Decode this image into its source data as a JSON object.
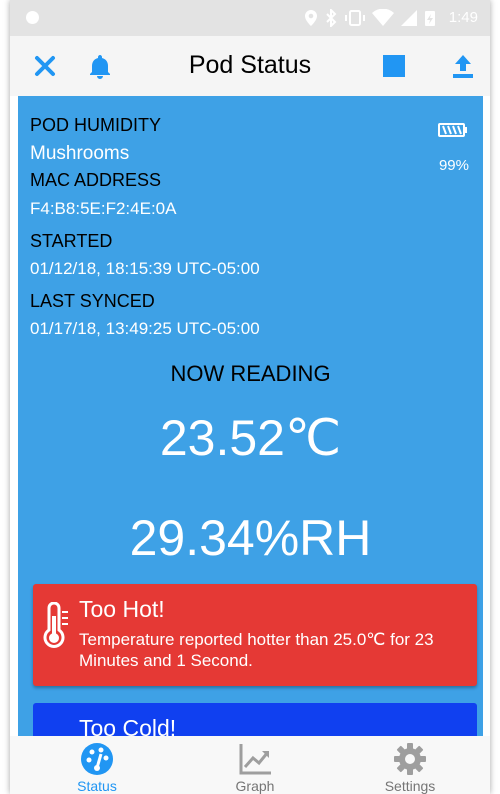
{
  "statusbar": {
    "time": "1:49"
  },
  "toolbar": {
    "title": "Pod Status"
  },
  "pod": {
    "humidity_label": "POD HUMIDITY",
    "humidity_value": "Mushrooms",
    "mac_label": "MAC ADDRESS",
    "mac_value": "F4:B8:5E:F2:4E:0A",
    "started_label": "STARTED",
    "started_value": "01/12/18, 18:15:39 UTC-05:00",
    "synced_label": "LAST SYNCED",
    "synced_value": "01/17/18, 13:49:25 UTC-05:00",
    "battery": "99%"
  },
  "reading": {
    "title": "NOW READING",
    "temperature": "23.52℃",
    "humidity": "29.34%RH"
  },
  "alerts": [
    {
      "title": "Too Hot!",
      "message": "Temperature reported hotter than 25.0℃ for 23 Minutes and 1 Second.",
      "color": "#e53935"
    },
    {
      "title": "Too Cold!",
      "message": "",
      "color": "#1040f0"
    }
  ],
  "nav": [
    {
      "label": "Status",
      "icon": "speedometer-icon",
      "active": true
    },
    {
      "label": "Graph",
      "icon": "chart-icon",
      "active": false
    },
    {
      "label": "Settings",
      "icon": "gear-icon",
      "active": false
    }
  ],
  "colors": {
    "accent": "#2196f3",
    "content_bg": "#3ea1e6",
    "hot": "#e53935",
    "cold": "#1040f0"
  }
}
